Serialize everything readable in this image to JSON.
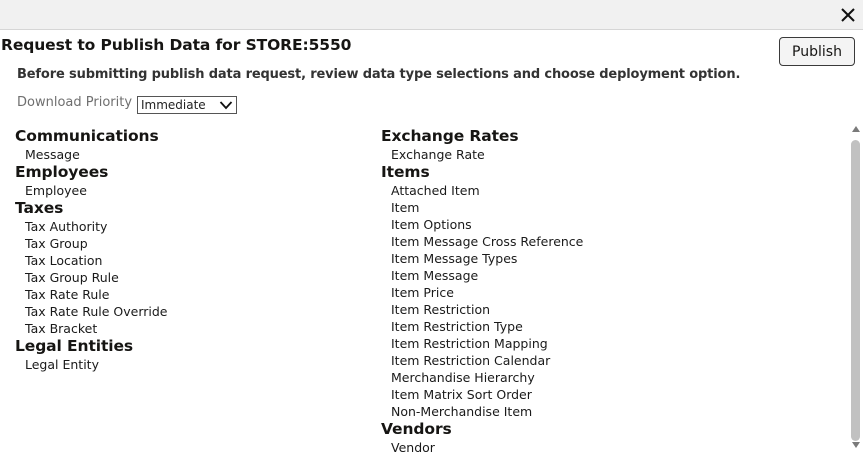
{
  "dialog": {
    "title": "Request to Publish Data for STORE:5550",
    "publish_label": "Publish",
    "instructions": "Before submitting publish data request, review data type selections and choose deployment option."
  },
  "priority": {
    "label": "Download Priority",
    "value": "Immediate"
  },
  "icons": {
    "close": "close-icon",
    "dropdown": "chevron-down-icon",
    "scroll_up": "triangle-up-icon",
    "scroll_down": "triangle-down-icon"
  },
  "left_groups": [
    {
      "heading": "Communications",
      "items": [
        "Message"
      ]
    },
    {
      "heading": "Employees",
      "items": [
        "Employee"
      ]
    },
    {
      "heading": "Taxes",
      "items": [
        "Tax Authority",
        "Tax Group",
        "Tax Location",
        "Tax Group Rule",
        "Tax Rate Rule",
        "Tax Rate Rule Override",
        "Tax Bracket"
      ]
    },
    {
      "heading": "Legal Entities",
      "items": [
        "Legal Entity"
      ]
    }
  ],
  "right_groups": [
    {
      "heading": "Exchange Rates",
      "items": [
        "Exchange Rate"
      ]
    },
    {
      "heading": "Items",
      "items": [
        "Attached Item",
        "Item",
        "Item Options",
        "Item Message Cross Reference",
        "Item Message Types",
        "Item Message",
        "Item Price",
        "Item Restriction",
        "Item Restriction Type",
        "Item Restriction Mapping",
        "Item Restriction Calendar",
        "Merchandise Hierarchy",
        "Item Matrix Sort Order",
        "Non-Merchandise Item"
      ]
    },
    {
      "heading": "Vendors",
      "items": [
        "Vendor"
      ]
    }
  ]
}
